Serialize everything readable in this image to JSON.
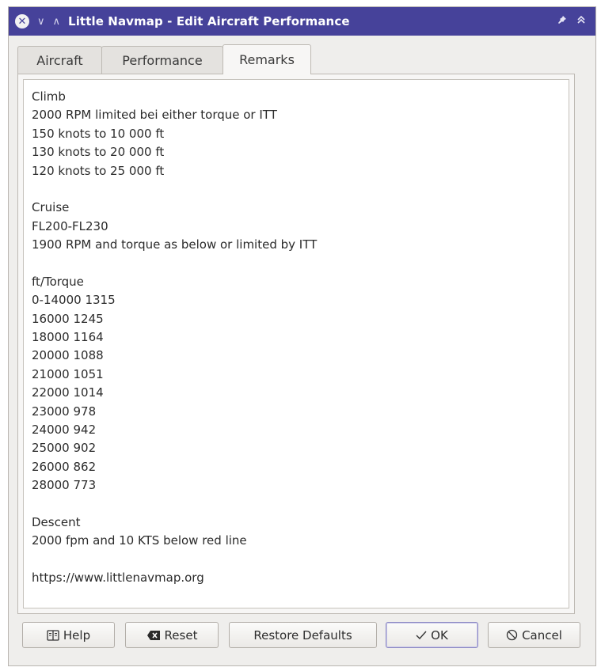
{
  "window": {
    "title": "Little Navmap - Edit Aircraft Performance"
  },
  "titlebar": {
    "close_glyph": "✕",
    "left_icons": [
      "close-icon",
      "chevron-down-icon",
      "chevron-up-icon"
    ],
    "right_icons": [
      "pin-icon",
      "keep-above-icon"
    ],
    "accent_color": "#46429a"
  },
  "tabs": [
    {
      "label": "Aircraft",
      "active": false
    },
    {
      "label": "Performance",
      "active": false
    },
    {
      "label": "Remarks",
      "active": true
    }
  ],
  "remarks": {
    "lines": [
      "Climb",
      "2000 RPM limited bei either torque or ITT",
      "150 knots to 10 000 ft",
      "130 knots to 20 000 ft",
      "120 knots to 25 000 ft",
      "",
      "Cruise",
      "FL200-FL230",
      "1900 RPM and torque as below or limited by ITT",
      "",
      "ft/Torque",
      "0-14000 1315",
      "16000 1245",
      "18000 1164",
      "20000 1088",
      "21000 1051",
      "22000 1014",
      "23000 978",
      "24000 942",
      "25000 902",
      "26000 862",
      "28000 773",
      "",
      "Descent",
      "2000 fpm and 10 KTS below red line",
      "",
      "https://www.littlenavmap.org"
    ]
  },
  "buttons": {
    "help_label": "Help",
    "reset_label": "Reset",
    "restore_label": "Restore Defaults",
    "ok_label": "OK",
    "cancel_label": "Cancel"
  }
}
